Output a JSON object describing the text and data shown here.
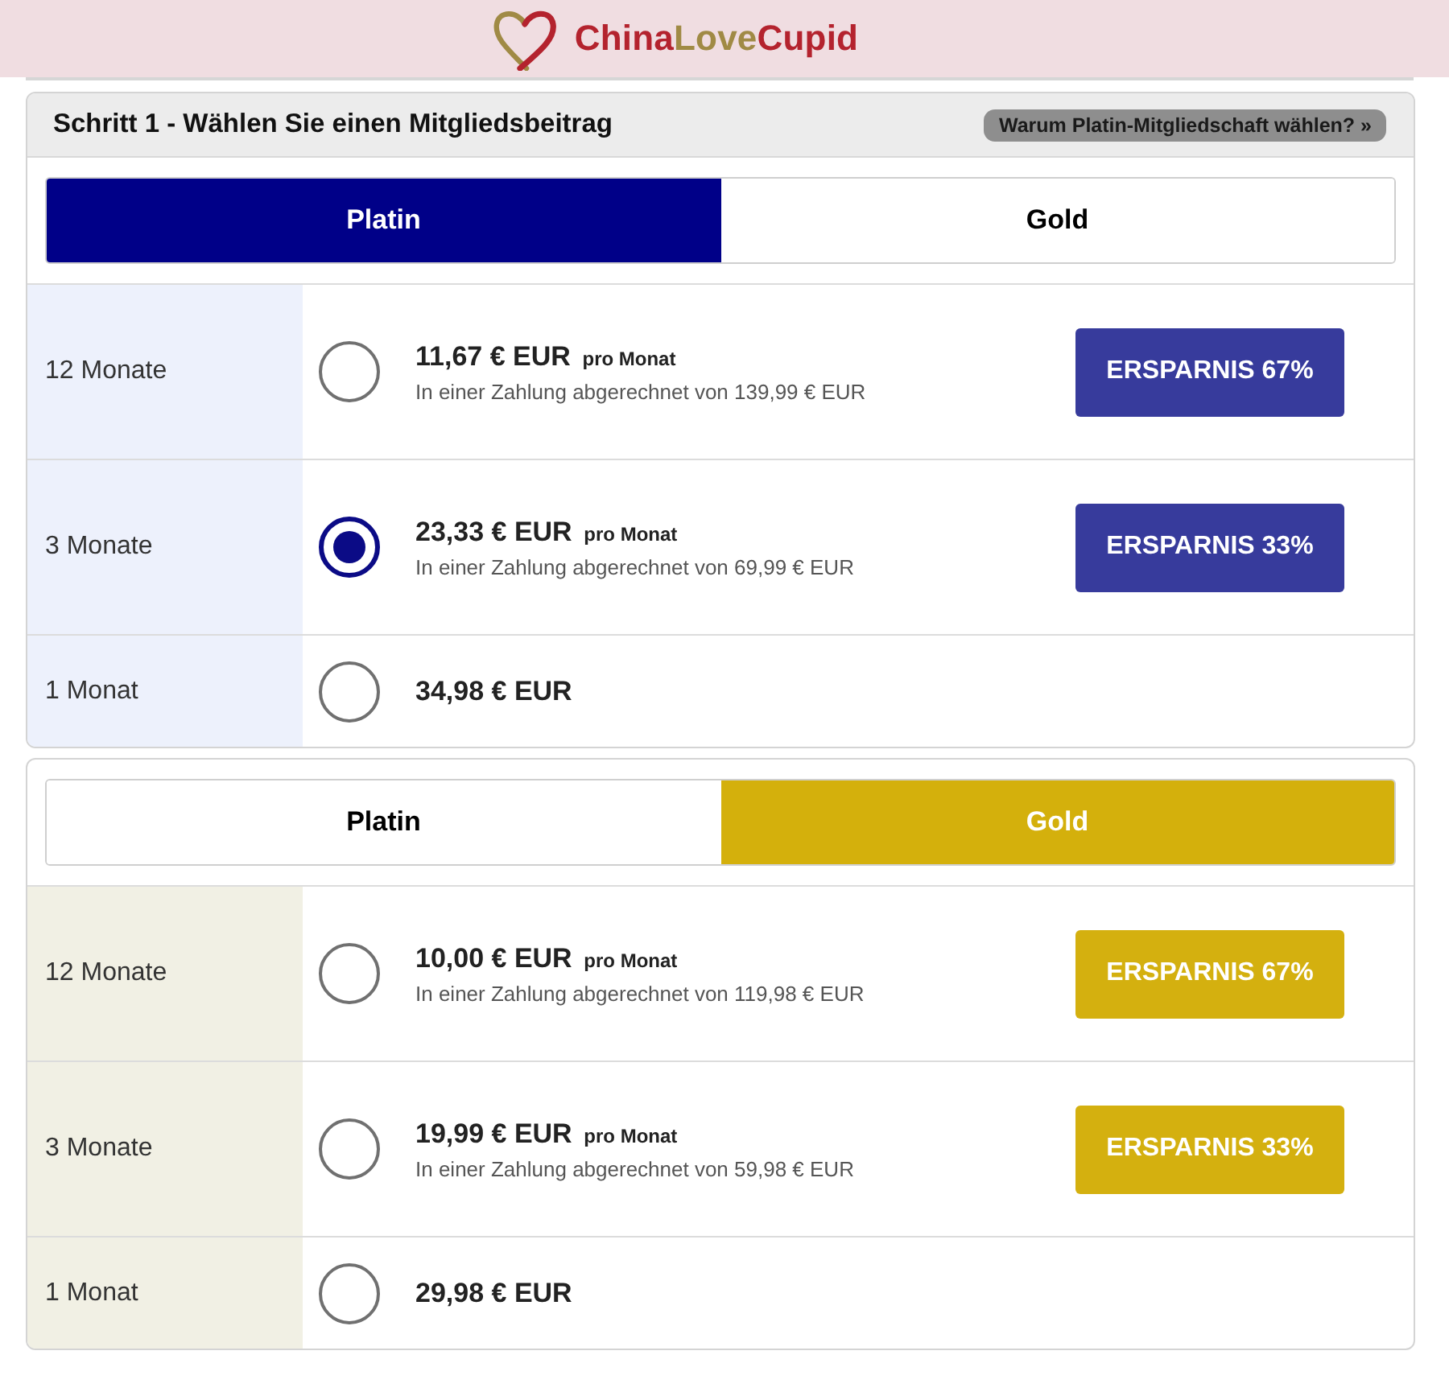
{
  "header": {
    "logo": [
      "China",
      "Love",
      "Cupid"
    ]
  },
  "panels": [
    {
      "title": "Schritt 1 - Wählen Sie einen Mitgliedsbeitrag",
      "info_link": "Warum Platin-Mitgliedschaft wählen? »",
      "tabs": [
        {
          "label": "Platin",
          "selected": true
        },
        {
          "label": "Gold",
          "selected": false
        }
      ],
      "plans": [
        {
          "term": "12 Monate",
          "selected": false,
          "price": "11,67 € EUR",
          "per": "pro Monat",
          "billing": "In einer Zahlung abgerechnet von 139,99 € EUR",
          "savings": "ERSPARNIS 67%"
        },
        {
          "term": "3 Monate",
          "selected": true,
          "price": "23,33 € EUR",
          "per": "pro Monat",
          "billing": "In einer Zahlung abgerechnet von 69,99 € EUR",
          "savings": "ERSPARNIS 33%"
        },
        {
          "term": "1 Monat",
          "selected": false,
          "price": "34,98 € EUR"
        }
      ]
    },
    {
      "tabs": [
        {
          "label": "Platin",
          "selected": false
        },
        {
          "label": "Gold",
          "selected": true
        }
      ],
      "plans": [
        {
          "term": "12 Monate",
          "selected": false,
          "price": "10,00 € EUR",
          "per": "pro Monat",
          "billing": "In einer Zahlung abgerechnet von 119,98 € EUR",
          "savings": "ERSPARNIS 67%"
        },
        {
          "term": "3 Monate",
          "selected": false,
          "price": "19,99 € EUR",
          "per": "pro Monat",
          "billing": "In einer Zahlung abgerechnet von 59,98 € EUR",
          "savings": "ERSPARNIS 33%"
        },
        {
          "term": "1 Monat",
          "selected": false,
          "price": "29,98 € EUR"
        }
      ]
    }
  ]
}
